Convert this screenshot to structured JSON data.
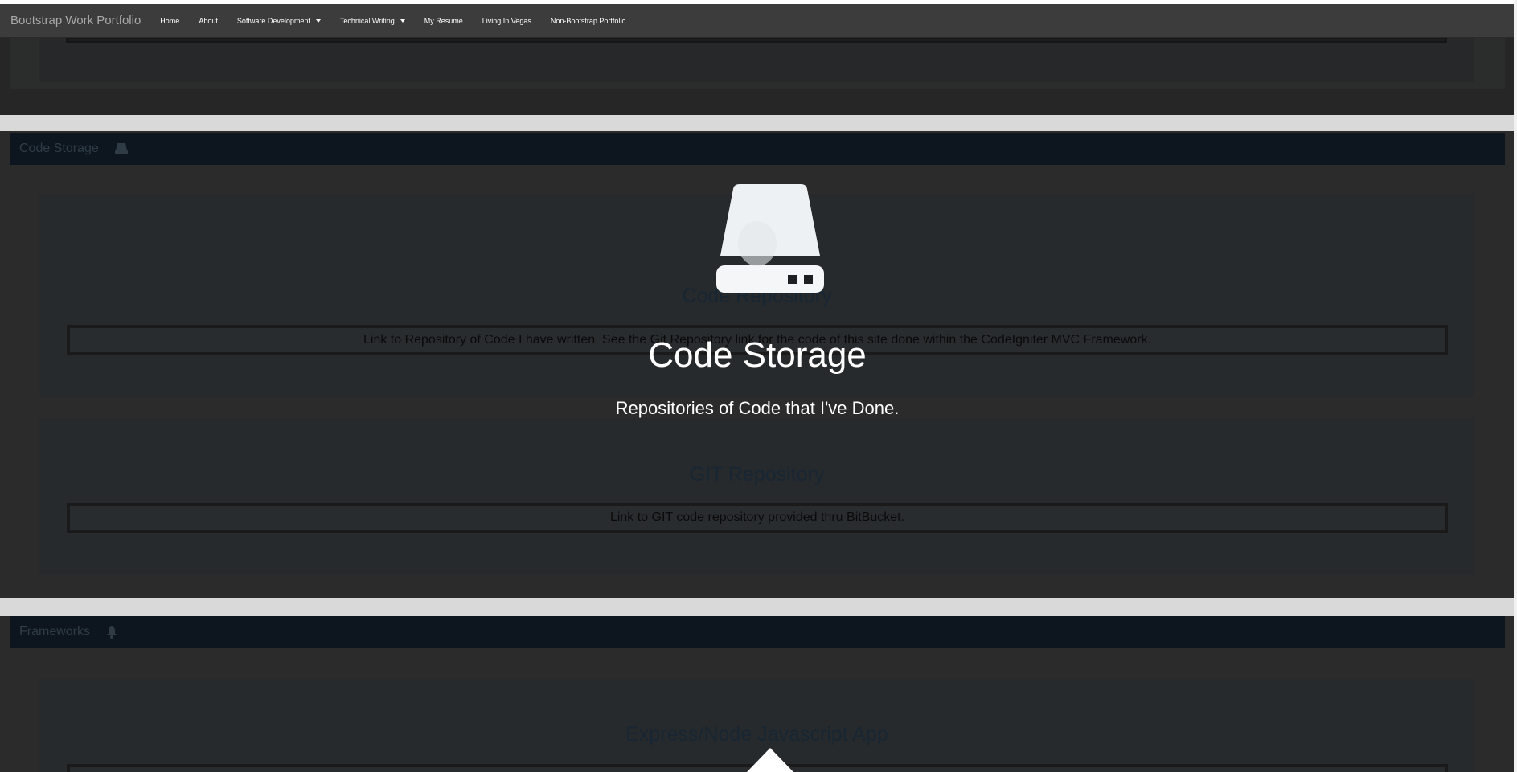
{
  "navbar": {
    "brand": "Bootstrap Work Portfolio",
    "items": [
      {
        "label": "Home",
        "dropdown": false
      },
      {
        "label": "About",
        "dropdown": false
      },
      {
        "label": "Software Development",
        "dropdown": true
      },
      {
        "label": "Technical Writing",
        "dropdown": true
      },
      {
        "label": "My Resume",
        "dropdown": false
      },
      {
        "label": "Living In Vegas",
        "dropdown": false
      },
      {
        "label": "Non-Bootstrap Portfolio",
        "dropdown": false
      }
    ]
  },
  "sections": {
    "code_storage": {
      "header": "Code Storage",
      "icon": "hard-drive-icon",
      "panels": [
        {
          "title": "Code Repository",
          "text": "Link to Repository of Code I have written. See the Git Repository link for the code of this site done within the CodeIgniter MVC Framework."
        },
        {
          "title": "GIT Repository",
          "text": "Link to GIT code repository provided thru BitBucket."
        }
      ]
    },
    "frameworks": {
      "header": "Frameworks",
      "icon": "bell-icon",
      "panels": [
        {
          "title": "Express/Node Javascript App"
        }
      ]
    }
  },
  "overlay": {
    "icon": "hard-drive-icon",
    "title": "Code Storage",
    "subtitle": "Repositories of Code that I've Done.",
    "arrow": "scroll-up-arrow-icon"
  },
  "colors": {
    "navbar": "#3c3c3c",
    "header_bar": "#0d161f",
    "page_bg": "#2b2b2b",
    "separator": "#d9d9d9",
    "overlay_text": "#ffffff"
  }
}
